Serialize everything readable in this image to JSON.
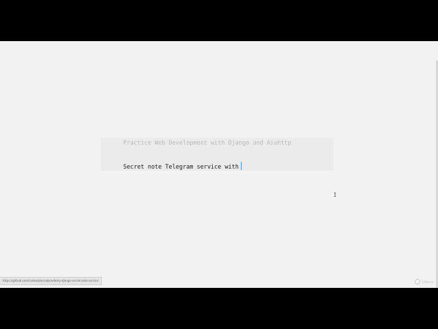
{
  "editor": {
    "placeholder_line": "Practice Web Development with Django and Aiohttp",
    "input_value": "Secret note Telegram service with"
  },
  "status_bar": {
    "link_url": "https://github.com/codeatater-labs/udemy-django-secret-note-service"
  },
  "watermark": {
    "label": "Udemy"
  },
  "colors": {
    "canvas_bg": "#f2f2f2",
    "editor_bg": "#ebebeb",
    "cursor": "#1d9bf0",
    "letterbox": "#000000"
  },
  "icons": {
    "mouse_pointer": "text-ibeam-icon",
    "watermark": "udemy-logo-icon"
  }
}
